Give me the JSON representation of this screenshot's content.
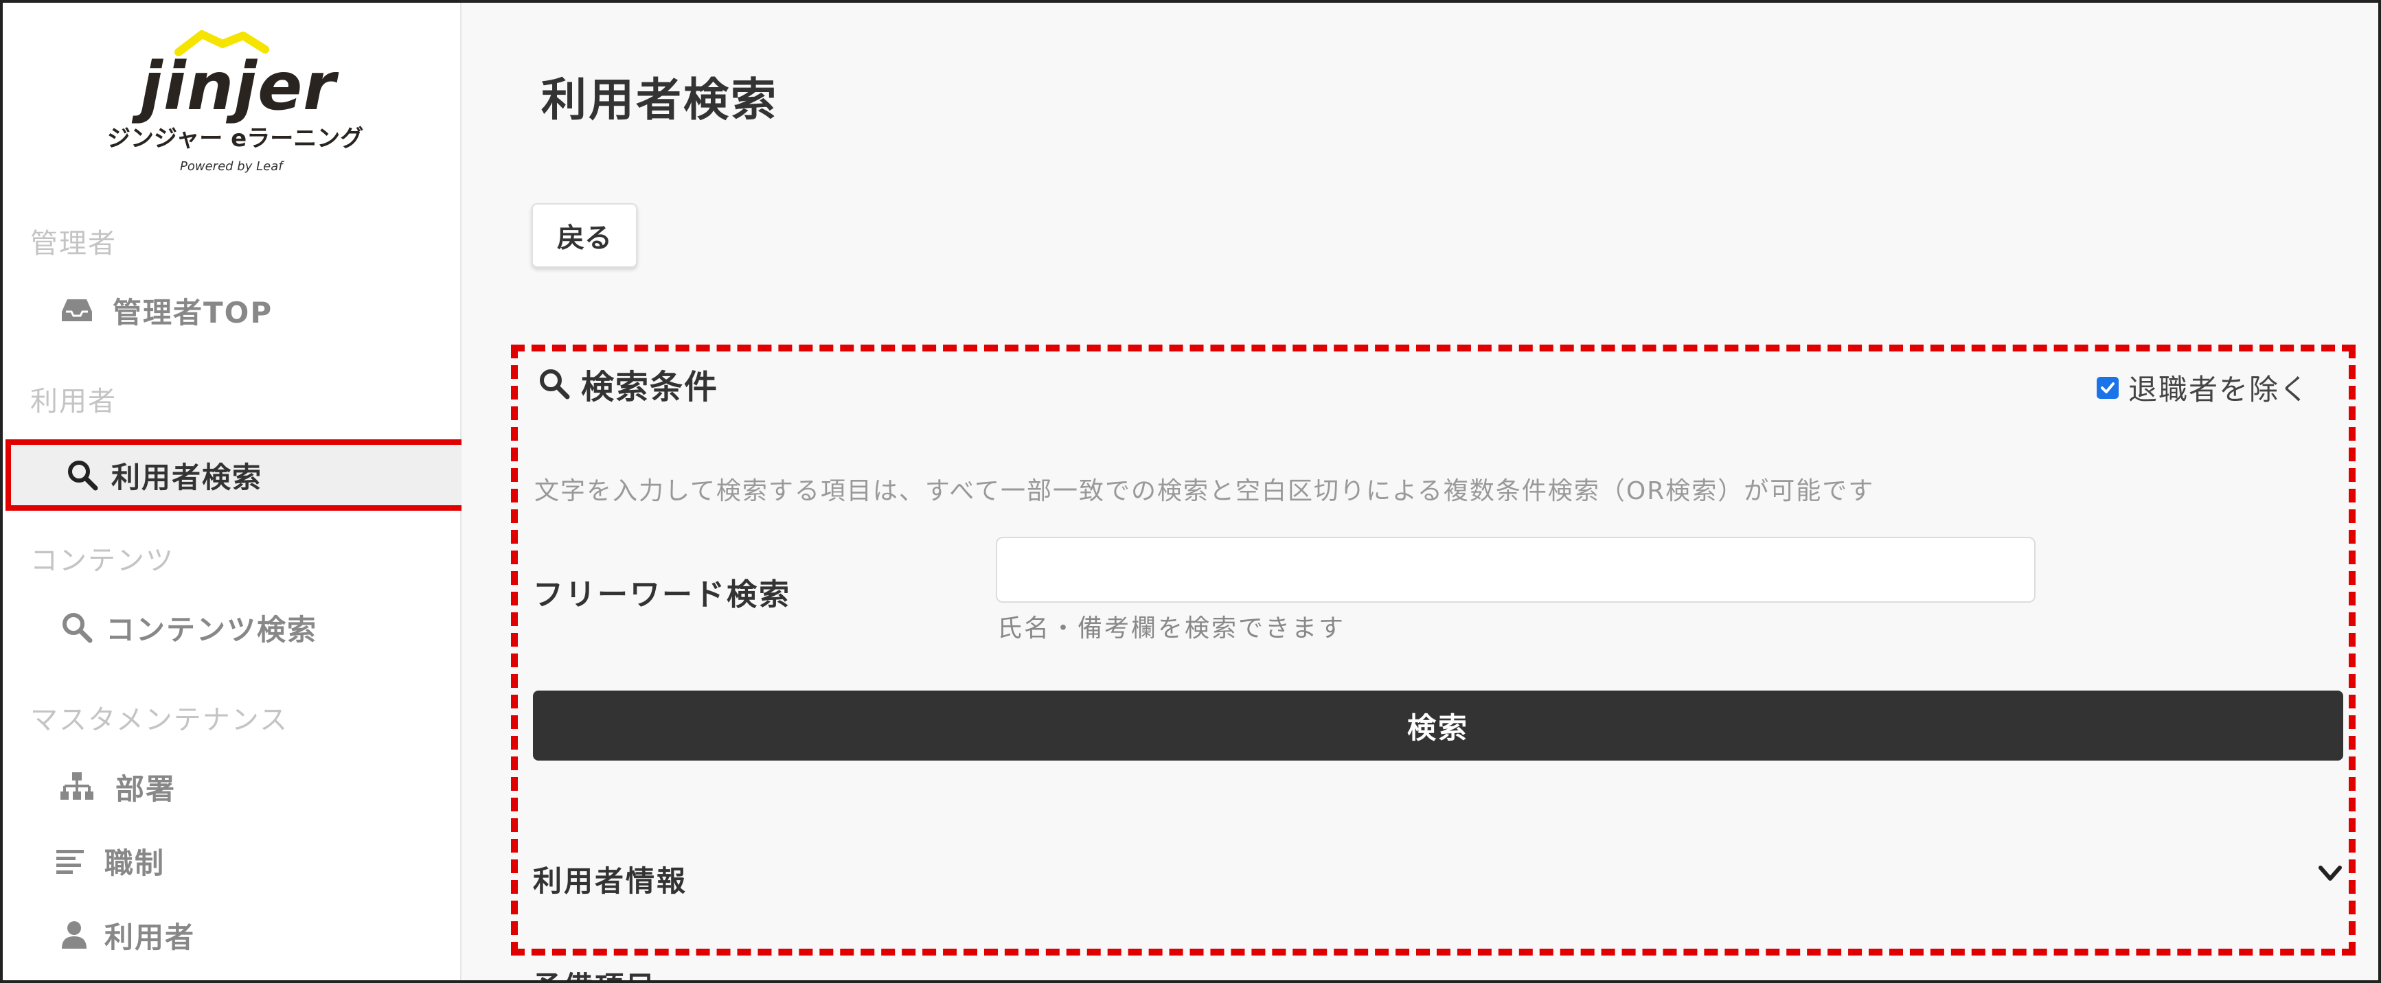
{
  "brand": {
    "wordmark": "jinjer",
    "product": "ジンジャー eラーニング",
    "powered": "Powered by Leaf",
    "accent_color": "#f5e400"
  },
  "sidebar": {
    "sections": [
      {
        "label": "管理者"
      },
      {
        "label": "利用者"
      },
      {
        "label": "コンテンツ"
      },
      {
        "label": "マスタメンテナンス"
      }
    ],
    "items": [
      {
        "label": "管理者TOP",
        "icon": "inbox-icon"
      },
      {
        "label": "利用者検索",
        "icon": "search-icon",
        "active": true
      },
      {
        "label": "コンテンツ検索",
        "icon": "search-icon"
      },
      {
        "label": "部署",
        "icon": "org-chart-icon"
      },
      {
        "label": "職制",
        "icon": "list-icon"
      },
      {
        "label": "利用者",
        "icon": "user-icon"
      }
    ]
  },
  "main": {
    "title": "利用者検索",
    "back_label": "戻る",
    "conditions": {
      "title": "検索条件",
      "exclude_label": "退職者を除く",
      "exclude_checked": true,
      "note": "文字を入力して検索する項目は、すべて一部一致での検索と空白区切りによる複数条件検索（OR検索）が可能です",
      "freeword_label": "フリーワード検索",
      "freeword_value": "",
      "freeword_help": "氏名・備考欄を検索できます",
      "search_label": "検索"
    },
    "user_info_label": "利用者情報",
    "spare_label": "予備項目"
  },
  "colors": {
    "highlight": "#e00000",
    "button_dark": "#333333",
    "checkbox": "#1a73e8"
  }
}
